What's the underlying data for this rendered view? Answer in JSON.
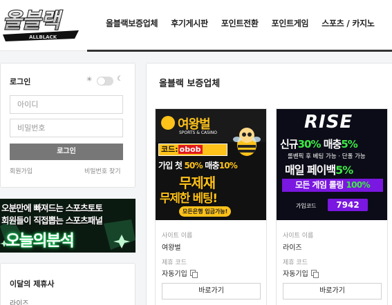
{
  "brand": {
    "logo_text": "올블랙",
    "logo_sub": "ALLBLACK"
  },
  "nav": [
    "올블랙보증업체",
    "후기게시판",
    "포인트전환",
    "포인트게임",
    "스포츠 / 카지노"
  ],
  "login": {
    "title": "로그인",
    "id_placeholder": "아이디",
    "pw_placeholder": "비밀번호",
    "button": "로그인",
    "signup": "회원가입",
    "find_pw": "비밀번호 찾기"
  },
  "left_banner": {
    "line1": "오분만에 빠져드는 스포츠토토",
    "line2": "회원들이 직접뽑는 스포츠패널",
    "line3": "오늘의분석"
  },
  "partners": {
    "title": "이달의 제휴사",
    "items": [
      "라이즈"
    ]
  },
  "main": {
    "title": "올블랙 보증업체",
    "cards": [
      {
        "site_label": "사이트 이름",
        "site_name": "여왕벌",
        "code_label": "제휴 코드",
        "code_value": "자동기입",
        "button": "바로가기",
        "banner": {
          "name": "여왕벌",
          "sub": "SPORTS & CASINO",
          "code_prefix": "코드:",
          "code": "obob",
          "line2_a": "가입 첫",
          "line2_b": "50%",
          "line2_c": "매충",
          "line2_d": "10%",
          "line3": "무제재",
          "line4": "무제한 베팅!",
          "line5": "모든은행 입금가능!"
        }
      },
      {
        "site_label": "사이트 이름",
        "site_name": "라이즈",
        "code_label": "제휴 코드",
        "code_value": "자동기입",
        "button": "바로가기",
        "banner": {
          "name": "RISE",
          "line1_a": "신규",
          "line1_b": "30%",
          "line1_c": "매충",
          "line1_d": "5%",
          "line2": "롤벤픽 후 베팅 가능 · 단폴 가능",
          "line3_a": "매일 페이백",
          "line3_b": "5%",
          "line4_a": "모든 게임 롤링",
          "line4_b": "100%",
          "code_label": "가입코드",
          "code": "7942"
        }
      }
    ]
  },
  "colors": {
    "accent_yellow": "#ffc21a",
    "accent_purple": "#7a17e0",
    "accent_green": "#3de845",
    "button_gray": "#777777"
  }
}
